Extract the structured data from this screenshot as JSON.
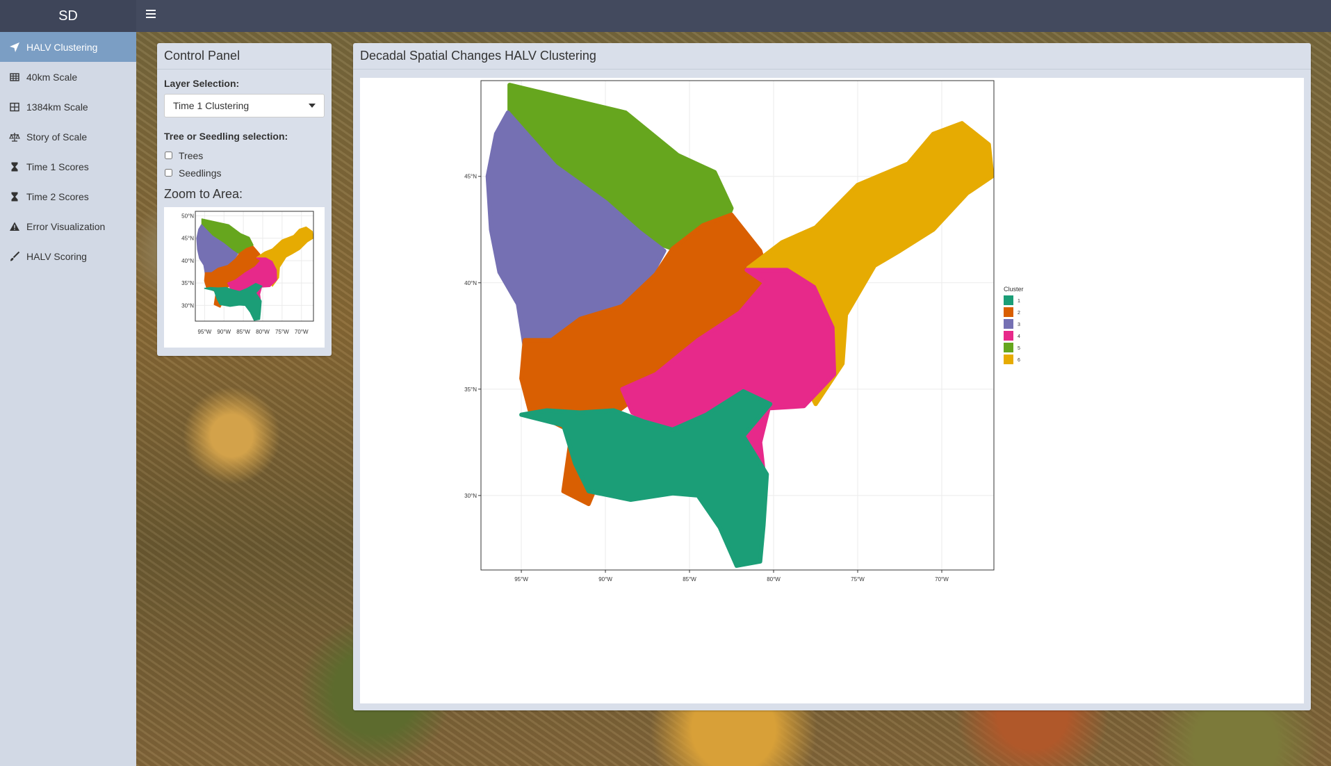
{
  "app": {
    "brand": "SD"
  },
  "sidebar": {
    "items": [
      {
        "label": "HALV Clustering",
        "icon": "paper-plane-icon",
        "active": true
      },
      {
        "label": "40km Scale",
        "icon": "table-icon",
        "active": false
      },
      {
        "label": "1384km Scale",
        "icon": "grid-icon",
        "active": false
      },
      {
        "label": "Story of Scale",
        "icon": "balance-scale-icon",
        "active": false
      },
      {
        "label": "Time 1 Scores",
        "icon": "hourglass-icon",
        "active": false
      },
      {
        "label": "Time 2 Scores",
        "icon": "hourglass-icon",
        "active": false
      },
      {
        "label": "Error Visualization",
        "icon": "warning-icon",
        "active": false
      },
      {
        "label": "HALV Scoring",
        "icon": "brush-icon",
        "active": false
      }
    ]
  },
  "control_panel": {
    "title": "Control Panel",
    "layer_label": "Layer Selection:",
    "layer_value": "Time 1 Clustering",
    "tree_label": "Tree or Seedling selection:",
    "options": [
      "Trees",
      "Seedlings"
    ],
    "zoom_label": "Zoom to Area:",
    "minimap_ticks": {
      "y": [
        "50°N",
        "45°N",
        "40°N",
        "35°N",
        "30°N"
      ],
      "x": [
        "95°W",
        "90°W",
        "85°W",
        "80°W",
        "75°W",
        "70°W"
      ]
    }
  },
  "main_panel": {
    "title": "Decadal Spatial Changes HALV Clustering"
  },
  "chart_data": {
    "type": "heatmap",
    "title": "",
    "xlabel": "",
    "ylabel": "",
    "x_ticks": [
      -95,
      -90,
      -85,
      -80,
      -75,
      -70
    ],
    "x_tick_labels": [
      "95°W",
      "90°W",
      "85°W",
      "80°W",
      "75°W",
      "70°W"
    ],
    "y_ticks": [
      30,
      35,
      40,
      45
    ],
    "y_tick_labels": [
      "30°N",
      "35°N",
      "40°N",
      "45°N"
    ],
    "xlim": [
      -97.4,
      -66.9
    ],
    "ylim": [
      26.5,
      49.5
    ],
    "grid": true,
    "legend": {
      "title": "Cluster",
      "position": "right",
      "entries": [
        {
          "label": "1",
          "color": "#1b9e77"
        },
        {
          "label": "2",
          "color": "#d95f02"
        },
        {
          "label": "3",
          "color": "#7570b3"
        },
        {
          "label": "4",
          "color": "#e7298a"
        },
        {
          "label": "5",
          "color": "#66a61e"
        },
        {
          "label": "6",
          "color": "#e6ab02"
        }
      ]
    },
    "regions": [
      {
        "cluster": "5",
        "points": [
          [
            -95.7,
            49.3
          ],
          [
            -88.8,
            48.0
          ],
          [
            -85.7,
            46.0
          ],
          [
            -83.5,
            45.2
          ],
          [
            -82.5,
            43.5
          ],
          [
            -83.0,
            42.5
          ],
          [
            -86.0,
            41.6
          ],
          [
            -88.5,
            42.3
          ],
          [
            -90.8,
            43.8
          ],
          [
            -93.0,
            45.2
          ],
          [
            -95.0,
            46.5
          ],
          [
            -95.7,
            48.0
          ]
        ]
      },
      {
        "cluster": "3",
        "points": [
          [
            -95.8,
            48.0
          ],
          [
            -93.0,
            45.5
          ],
          [
            -90.0,
            43.8
          ],
          [
            -88.0,
            42.4
          ],
          [
            -86.5,
            41.5
          ],
          [
            -87.5,
            40.0
          ],
          [
            -89.0,
            38.8
          ],
          [
            -91.5,
            38.2
          ],
          [
            -93.2,
            37.0
          ],
          [
            -94.8,
            37.0
          ],
          [
            -95.2,
            39.0
          ],
          [
            -96.3,
            40.5
          ],
          [
            -96.8,
            42.5
          ],
          [
            -97.0,
            45.0
          ],
          [
            -96.5,
            47.0
          ]
        ]
      },
      {
        "cluster": "2",
        "points": [
          [
            -94.8,
            37.3
          ],
          [
            -93.2,
            37.3
          ],
          [
            -91.5,
            38.3
          ],
          [
            -89.0,
            38.9
          ],
          [
            -87.0,
            40.4
          ],
          [
            -86.0,
            41.6
          ],
          [
            -84.2,
            42.7
          ],
          [
            -82.5,
            43.2
          ],
          [
            -80.8,
            41.5
          ],
          [
            -80.2,
            40.0
          ],
          [
            -81.8,
            38.5
          ],
          [
            -84.5,
            37.2
          ],
          [
            -87.0,
            35.3
          ],
          [
            -89.2,
            34.0
          ],
          [
            -90.0,
            31.5
          ],
          [
            -91.0,
            29.6
          ],
          [
            -92.5,
            30.2
          ],
          [
            -92.0,
            33.0
          ],
          [
            -94.5,
            34.0
          ],
          [
            -95.0,
            35.5
          ]
        ]
      },
      {
        "cluster": "6",
        "points": [
          [
            -81.5,
            40.7
          ],
          [
            -79.5,
            41.9
          ],
          [
            -77.5,
            42.6
          ],
          [
            -75.0,
            44.6
          ],
          [
            -72.0,
            45.6
          ],
          [
            -70.5,
            47.0
          ],
          [
            -68.8,
            47.5
          ],
          [
            -67.2,
            46.5
          ],
          [
            -67.0,
            45.0
          ],
          [
            -68.5,
            44.2
          ],
          [
            -70.5,
            42.5
          ],
          [
            -72.5,
            41.5
          ],
          [
            -74.0,
            40.8
          ],
          [
            -75.7,
            38.5
          ],
          [
            -75.9,
            36.2
          ],
          [
            -77.5,
            34.3
          ],
          [
            -78.2,
            35.4
          ],
          [
            -76.5,
            37.8
          ],
          [
            -77.5,
            39.8
          ],
          [
            -79.0,
            40.4
          ]
        ]
      },
      {
        "cluster": "4",
        "points": [
          [
            -81.6,
            40.6
          ],
          [
            -79.2,
            40.6
          ],
          [
            -77.6,
            39.8
          ],
          [
            -76.5,
            37.9
          ],
          [
            -76.4,
            35.7
          ],
          [
            -78.2,
            34.2
          ],
          [
            -80.3,
            34.1
          ],
          [
            -80.8,
            32.5
          ],
          [
            -80.5,
            30.5
          ],
          [
            -82.0,
            30.0
          ],
          [
            -84.6,
            31.8
          ],
          [
            -86.9,
            33.3
          ],
          [
            -88.4,
            33.9
          ],
          [
            -89.0,
            35.0
          ],
          [
            -87.0,
            35.7
          ],
          [
            -84.5,
            37.3
          ],
          [
            -82.0,
            38.6
          ],
          [
            -80.5,
            40.0
          ]
        ]
      },
      {
        "cluster": "1",
        "points": [
          [
            -95.0,
            33.8
          ],
          [
            -92.5,
            33.3
          ],
          [
            -91.8,
            31.5
          ],
          [
            -91.0,
            30.2
          ],
          [
            -88.5,
            29.8
          ],
          [
            -86.0,
            30.1
          ],
          [
            -84.5,
            30.0
          ],
          [
            -83.2,
            28.5
          ],
          [
            -82.2,
            26.7
          ],
          [
            -80.8,
            26.9
          ],
          [
            -80.6,
            28.6
          ],
          [
            -80.4,
            31.0
          ],
          [
            -81.8,
            32.8
          ],
          [
            -80.2,
            34.3
          ],
          [
            -81.8,
            34.9
          ],
          [
            -84.0,
            33.8
          ],
          [
            -86.0,
            33.1
          ],
          [
            -87.8,
            33.5
          ],
          [
            -89.5,
            34.0
          ],
          [
            -91.5,
            33.9
          ],
          [
            -93.5,
            34.0
          ]
        ]
      }
    ]
  }
}
